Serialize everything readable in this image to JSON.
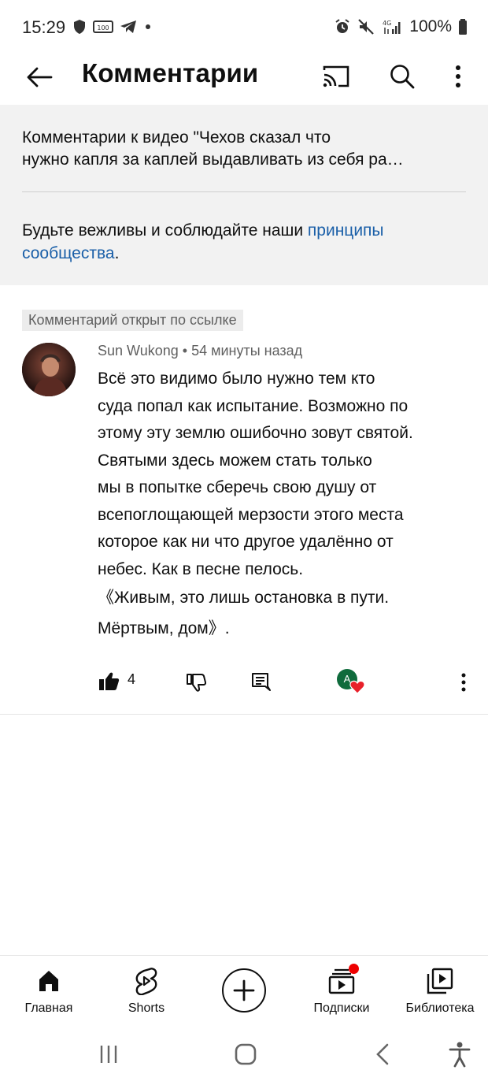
{
  "status_bar": {
    "time": "15:29",
    "battery": "100%",
    "network": "4G"
  },
  "app_bar": {
    "title": "Комментарии"
  },
  "header": {
    "video_title_line1": "Комментарии к видео \"Чехов сказал что",
    "video_title_line2": "нужно капля за каплей выдавливать из себя ра…",
    "guidelines_prefix": "Будьте вежливы и соблюдайте наши ",
    "guidelines_link_part1": "принципы",
    "guidelines_link_part2": "сообщества",
    "guidelines_suffix": "."
  },
  "comment": {
    "linked_badge": "Комментарий открыт по ссылке",
    "author": "Sun Wukong",
    "separator": " • ",
    "time": "54 минуты назад",
    "lines": [
      "Всё это видимо было нужно тем кто",
      "суда попал как испытание. Возможно по",
      "этому эту землю ошибочно зовут святой.",
      "Святыми здесь можем стать только",
      "мы в попытке сберечь свою душу от",
      "всепоглощающей мерзости этого места",
      "которое  как ни что другое удалённо от",
      "небес. Как в песне пелось.",
      "《Живым, это лишь остановка в пути.",
      "Мёртвым, дом》."
    ],
    "like_count": "4",
    "creator_initial": "A"
  },
  "bottom_nav": {
    "items": [
      {
        "label": "Главная",
        "icon": "home-icon"
      },
      {
        "label": "Shorts",
        "icon": "shorts-icon"
      },
      {
        "label": "",
        "icon": "create-icon"
      },
      {
        "label": "Подписки",
        "icon": "subscriptions-icon"
      },
      {
        "label": "Библиотека",
        "icon": "library-icon"
      }
    ]
  },
  "colors": {
    "link": "#1a5fa8",
    "header_bg": "#f2f2f2",
    "accent_red": "#ee0000",
    "creator_green": "#0f6b3c"
  }
}
